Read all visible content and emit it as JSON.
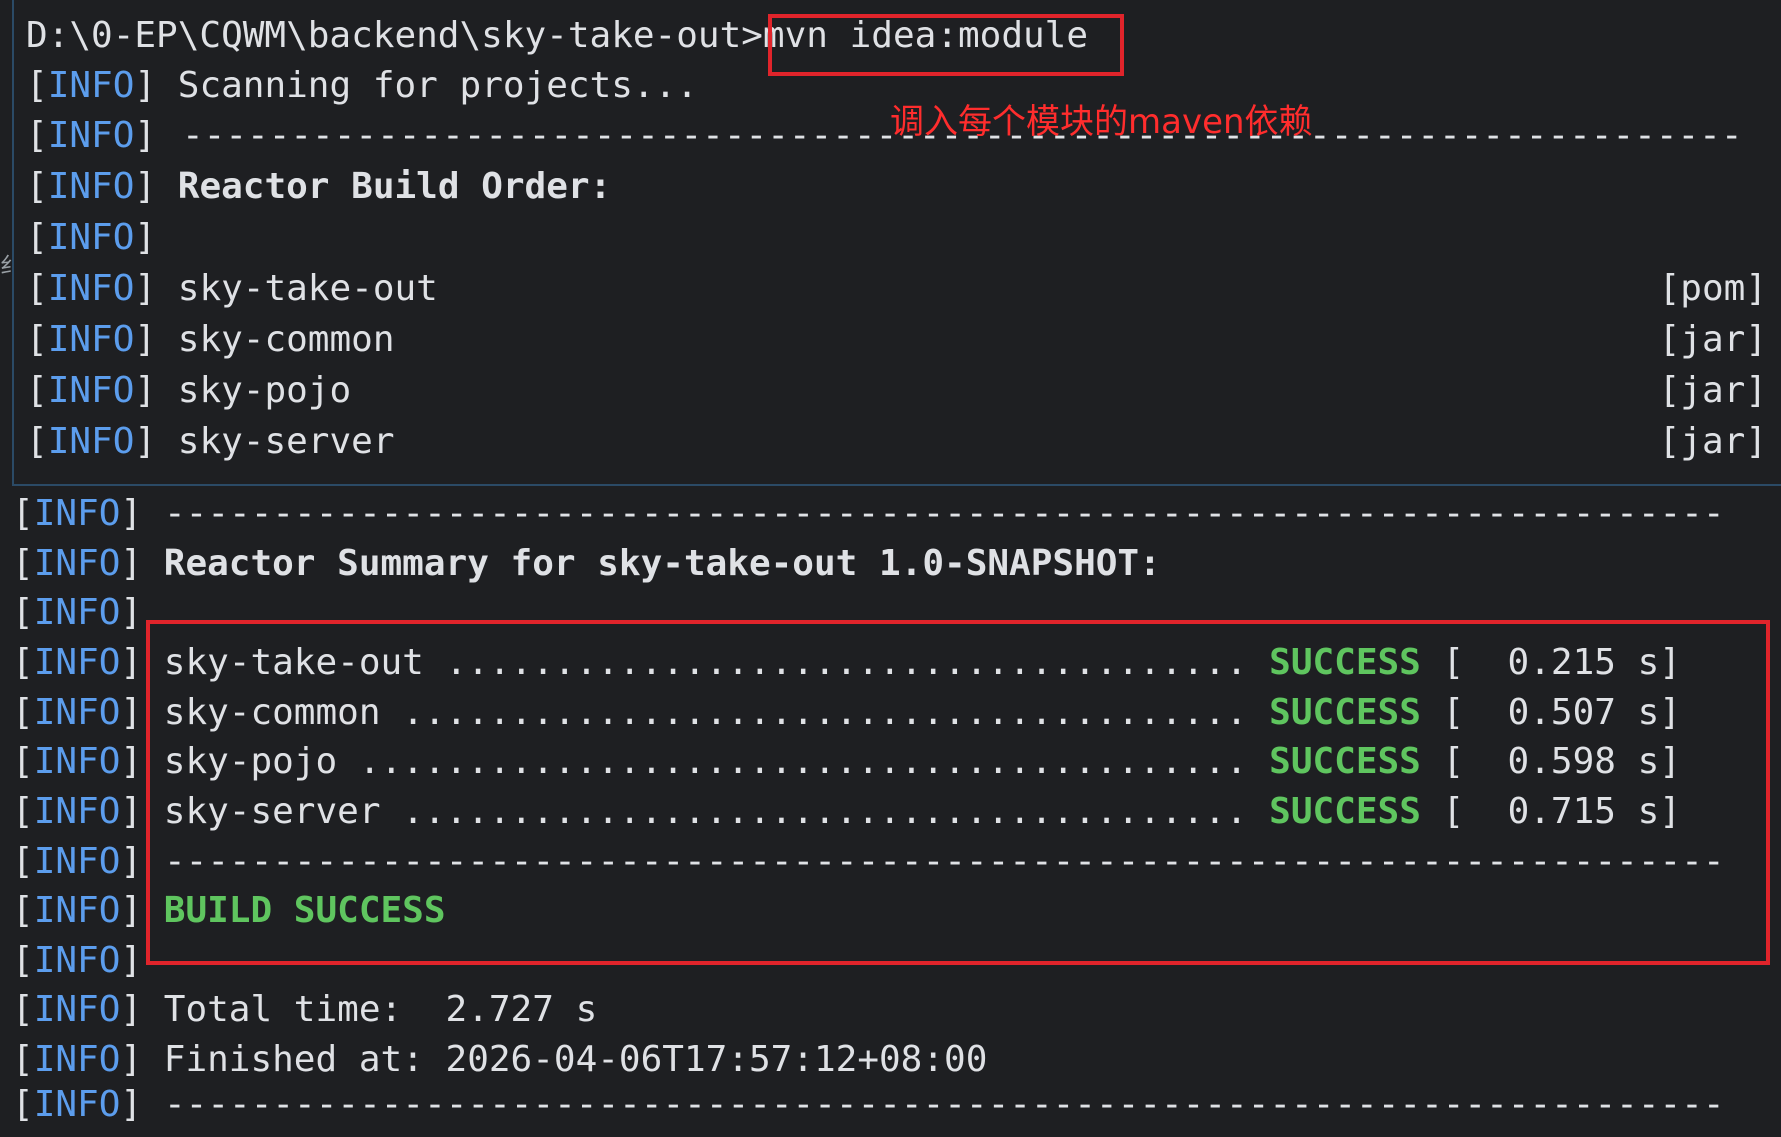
{
  "prompt": {
    "path": "D:\\0-EP\\CQWM\\backend\\sky-take-out>",
    "command": "mvn idea:module"
  },
  "annotation": "调入每个模块的maven依赖",
  "tag": {
    "open": "[",
    "word": "INFO",
    "close": "]"
  },
  "top_lines": {
    "scanning": "Scanning for projects...",
    "dashes": "------------------------------------------------------------------------",
    "reactor_build_order": "Reactor Build Order:",
    "modules": [
      {
        "name": "sky-take-out",
        "packaging": "[pom]"
      },
      {
        "name": "sky-common",
        "packaging": "[jar]"
      },
      {
        "name": "sky-pojo",
        "packaging": "[jar]"
      },
      {
        "name": "sky-server",
        "packaging": "[jar]"
      }
    ]
  },
  "edge_glyph": "纟",
  "bottom_lines": {
    "dashes": "------------------------------------------------------------------------",
    "summary_title": "Reactor Summary for sky-take-out 1.0-SNAPSHOT:",
    "results": [
      {
        "name": "sky-take-out",
        "dots": " ..................................... ",
        "status": "SUCCESS",
        "time": " [  0.215 s]"
      },
      {
        "name": "sky-common",
        "dots": " ....................................... ",
        "status": "SUCCESS",
        "time": " [  0.507 s]"
      },
      {
        "name": "sky-pojo",
        "dots": " ......................................... ",
        "status": "SUCCESS",
        "time": " [  0.598 s]"
      },
      {
        "name": "sky-server",
        "dots": " ....................................... ",
        "status": "SUCCESS",
        "time": " [  0.715 s]"
      }
    ],
    "build_success": "BUILD SUCCESS",
    "total_time": "Total time:  2.727 s",
    "finished_at": "Finished at: 2026-04-06T17:57:12+08:00"
  },
  "colors": {
    "background": "#1e1f22",
    "text": "#dfe1e5",
    "info": "#5c9ded",
    "success": "#5fc55f",
    "highlight_box": "#e0242b",
    "annotation": "#ff2d2d"
  }
}
